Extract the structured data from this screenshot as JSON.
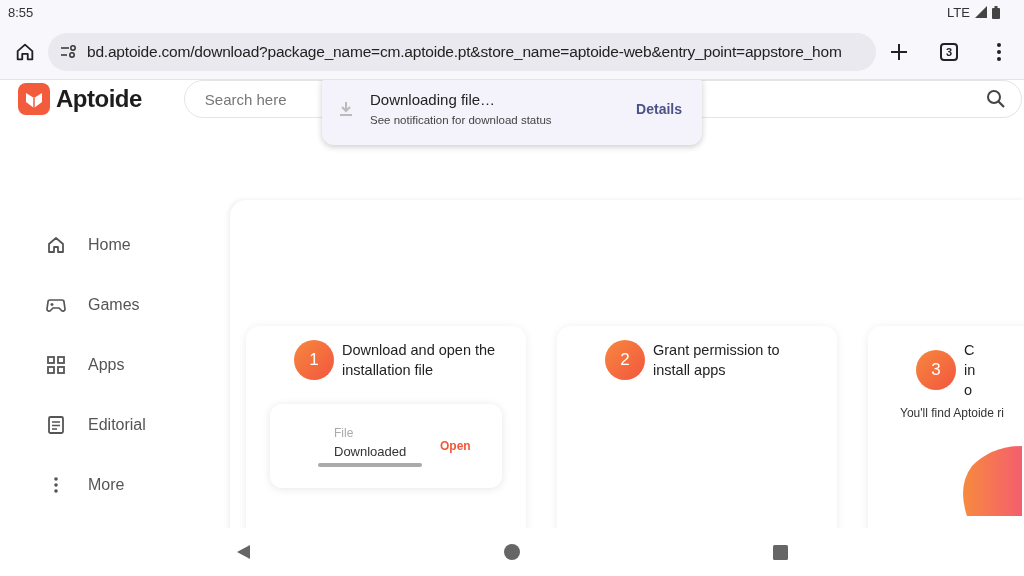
{
  "status_bar": {
    "time": "8:55",
    "network": "LTE"
  },
  "browser": {
    "url": "bd.aptoide.com/download?package_name=cm.aptoide.pt&store_name=aptoide-web&entry_point=appstore_hom",
    "tab_count": "3"
  },
  "download_popup": {
    "title": "Downloading file…",
    "subtitle": "See notification for download status",
    "action": "Details"
  },
  "header": {
    "logo": "Aptoide",
    "search": {
      "placeholder": "Search here"
    }
  },
  "sidebar": {
    "items": [
      {
        "label": "Home"
      },
      {
        "label": "Games"
      },
      {
        "label": "Apps"
      },
      {
        "label": "Editorial"
      },
      {
        "label": "More"
      }
    ]
  },
  "steps": [
    {
      "number": "1",
      "title": "Download and open the installation file",
      "file_box": {
        "name": "File",
        "status": "Downloaded",
        "level": 1,
        "action": "Open"
      }
    },
    {
      "number": "2",
      "title": "Grant permission to install apps"
    },
    {
      "number": "3",
      "title_lines": [
        "C",
        "in",
        "o"
      ],
      "note": "You'll find Aptoide ri",
      "kind": "picture"
    }
  ]
}
